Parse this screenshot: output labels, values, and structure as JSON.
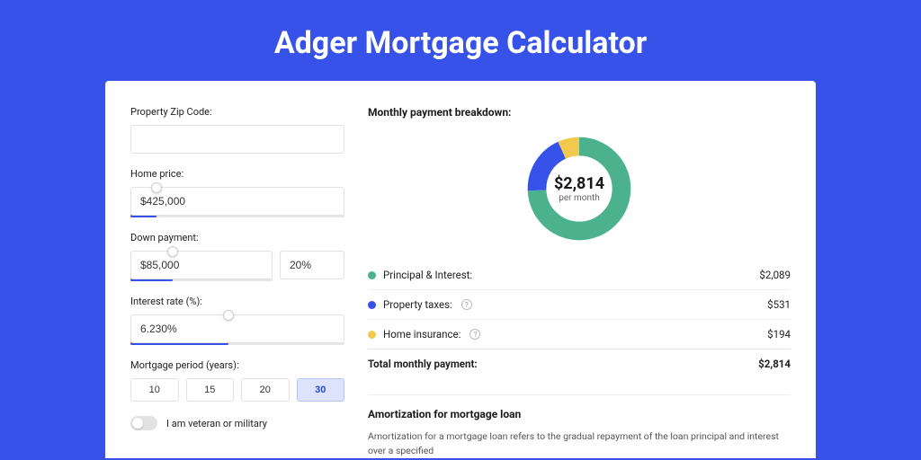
{
  "title": "Adger Mortgage Calculator",
  "form": {
    "zip_label": "Property Zip Code:",
    "zip_value": "",
    "home_price_label": "Home price:",
    "home_price_value": "$425,000",
    "home_price_slider_pct": 12,
    "down_payment_label": "Down payment:",
    "down_payment_value": "$85,000",
    "down_payment_pct_value": "20%",
    "down_payment_slider_pct": 30,
    "interest_label": "Interest rate (%):",
    "interest_value": "6.230%",
    "interest_slider_pct": 46,
    "period_label": "Mortgage period (years):",
    "periods": [
      "10",
      "15",
      "20",
      "30"
    ],
    "period_selected": "30",
    "veteran_label": "I am veteran or military"
  },
  "breakdown": {
    "title": "Monthly payment breakdown:",
    "center_amount": "$2,814",
    "center_sub": "per month",
    "items": [
      {
        "label": "Principal & Interest:",
        "value": "$2,089",
        "color": "#4cb28e",
        "has_info": false
      },
      {
        "label": "Property taxes:",
        "value": "$531",
        "color": "#3652e8",
        "has_info": true
      },
      {
        "label": "Home insurance:",
        "value": "$194",
        "color": "#f2c94c",
        "has_info": true
      }
    ],
    "total_label": "Total monthly payment:",
    "total_value": "$2,814"
  },
  "chart_data": {
    "type": "pie",
    "title": "Monthly payment breakdown",
    "categories": [
      "Principal & Interest",
      "Property taxes",
      "Home insurance"
    ],
    "values": [
      2089,
      531,
      194
    ],
    "colors": [
      "#4cb28e",
      "#3652e8",
      "#f2c94c"
    ],
    "total": 2814
  },
  "amort": {
    "title": "Amortization for mortgage loan",
    "text": "Amortization for a mortgage loan refers to the gradual repayment of the loan principal and interest over a specified"
  }
}
